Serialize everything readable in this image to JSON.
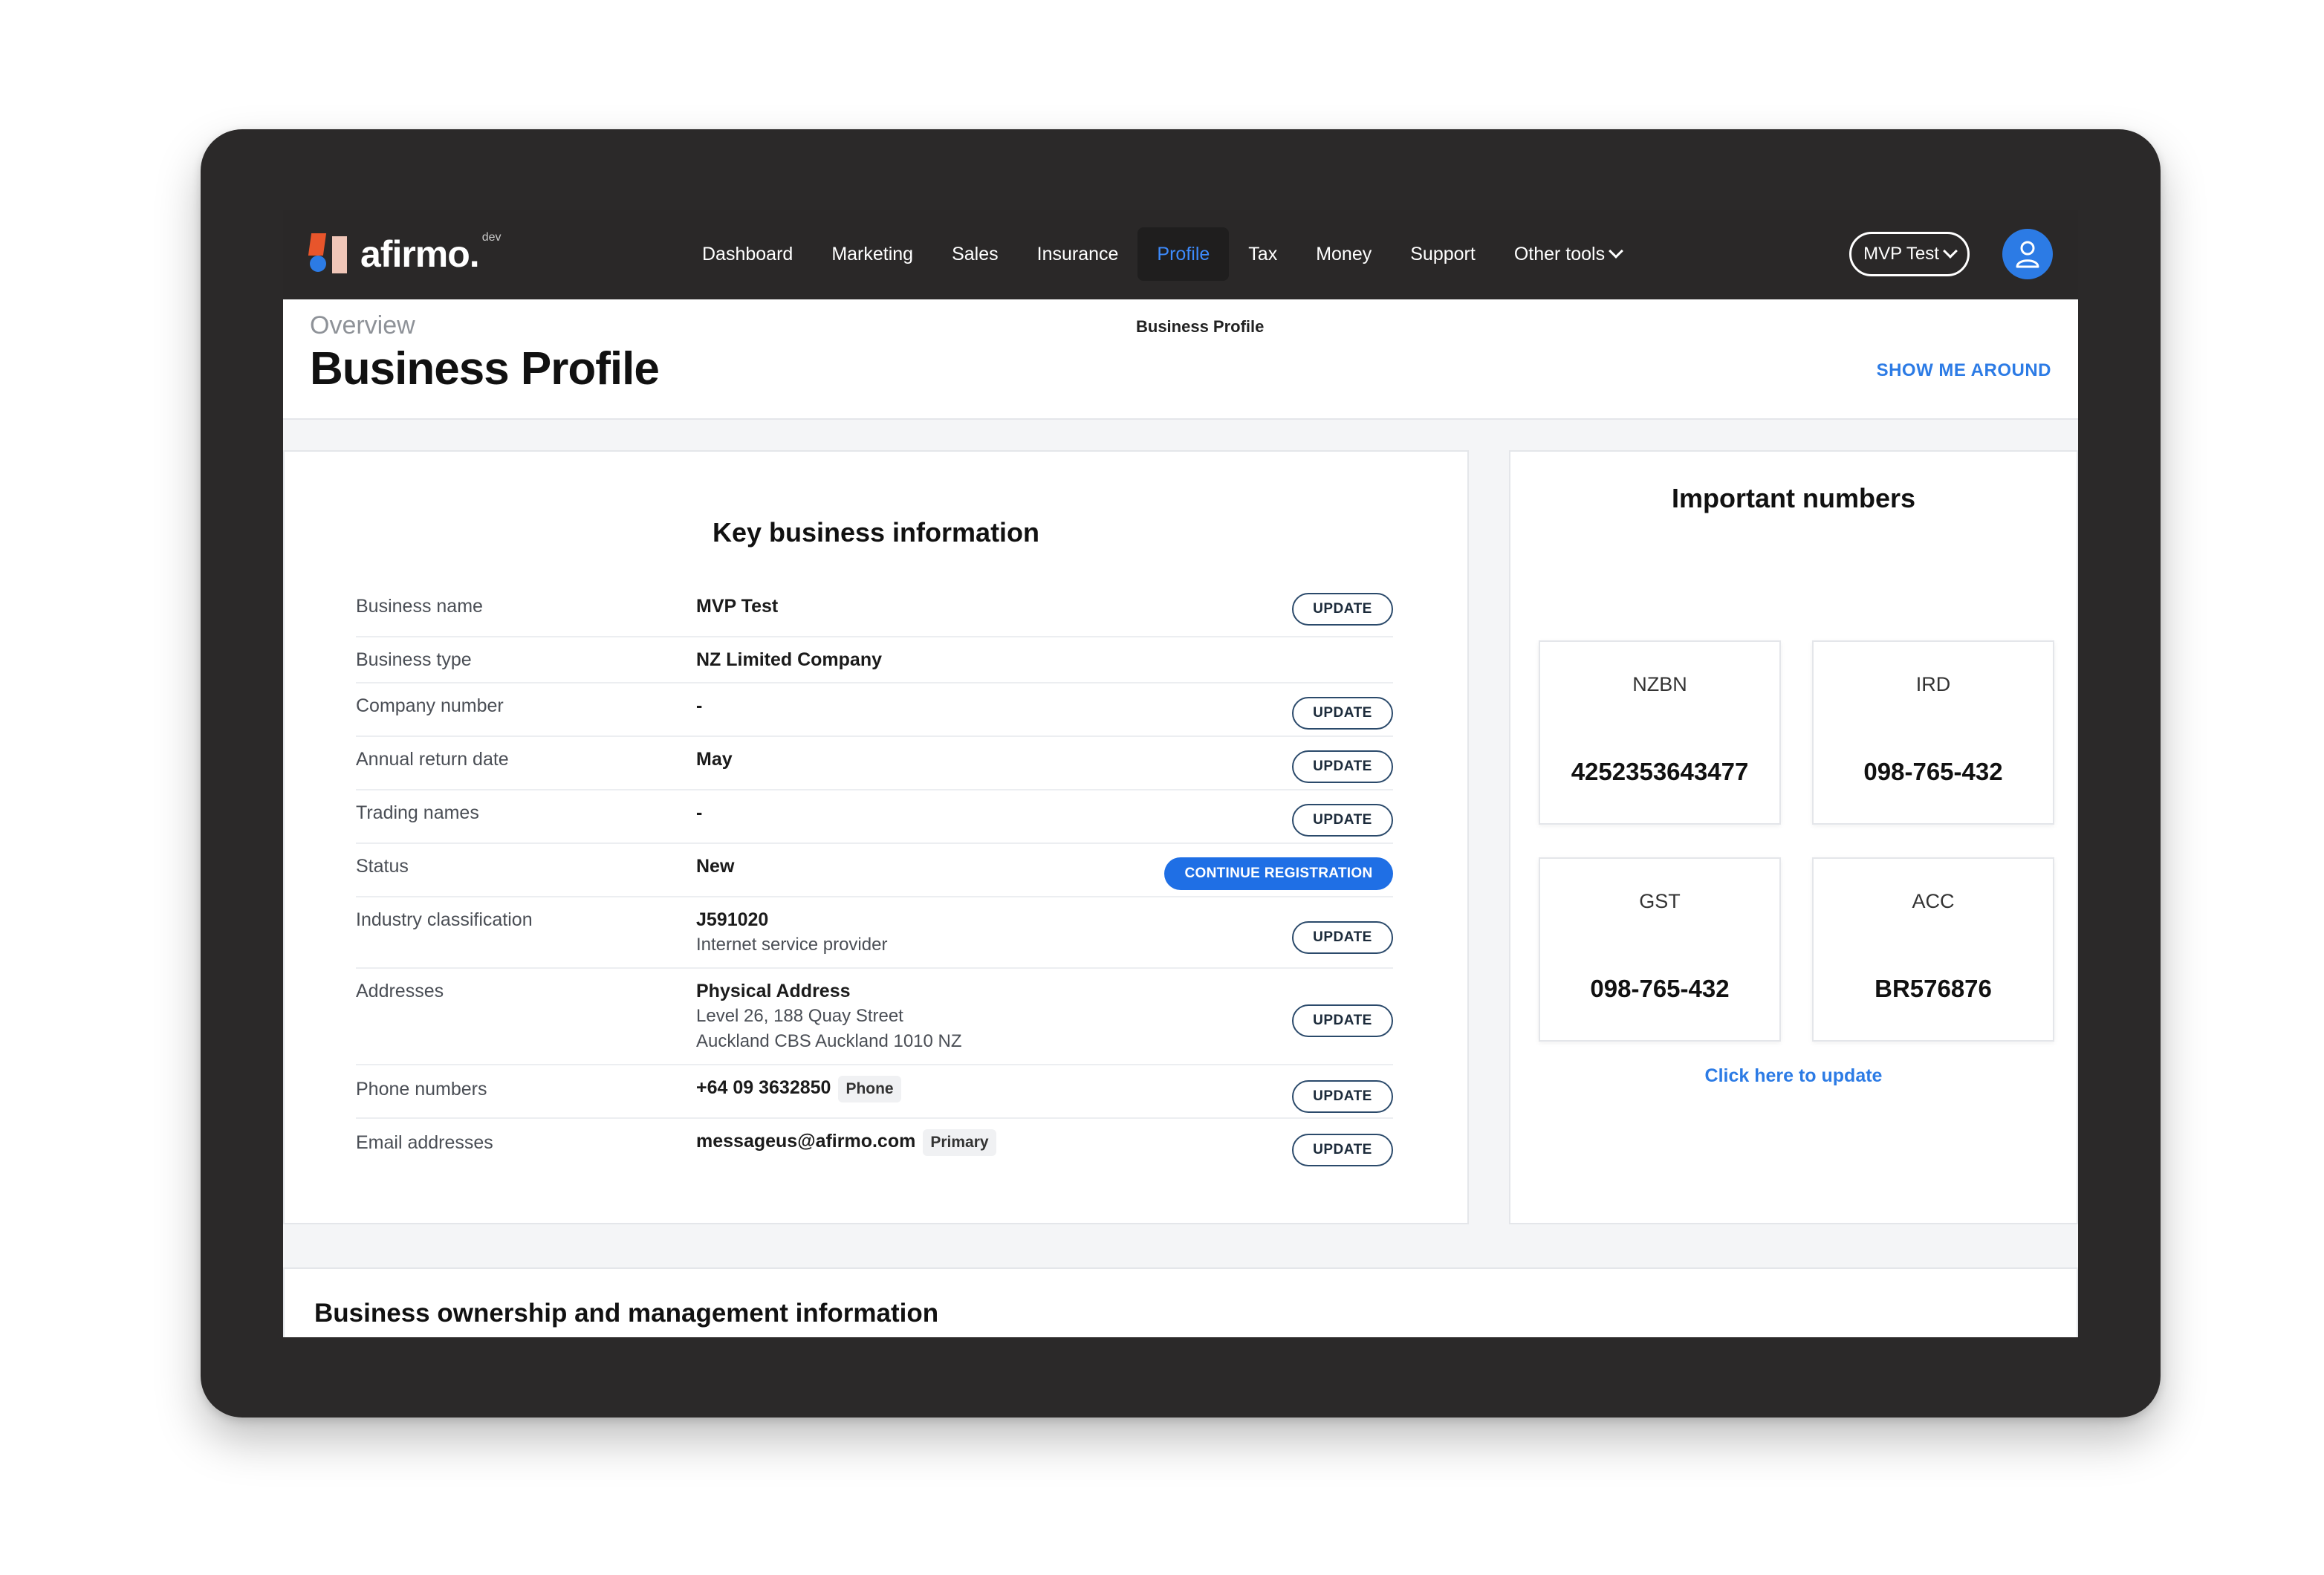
{
  "brand": {
    "name": "afirmo.",
    "env": "dev"
  },
  "nav": {
    "items": [
      "Dashboard",
      "Marketing",
      "Sales",
      "Insurance",
      "Profile",
      "Tax",
      "Money",
      "Support",
      "Other tools"
    ],
    "active": "Profile"
  },
  "account": {
    "label": "MVP Test"
  },
  "header": {
    "overview": "Overview",
    "title": "Business Profile",
    "breadcrumb": "Business Profile",
    "show_me_around": "SHOW ME AROUND"
  },
  "key_info": {
    "title": "Key business information",
    "update_label": "UPDATE",
    "continue_label": "CONTINUE REGISTRATION",
    "rows": {
      "business_name": {
        "label": "Business name",
        "value": "MVP Test"
      },
      "business_type": {
        "label": "Business type",
        "value": "NZ Limited Company"
      },
      "company_number": {
        "label": "Company number",
        "value": "-"
      },
      "annual_return": {
        "label": "Annual return date",
        "value": "May"
      },
      "trading_names": {
        "label": "Trading names",
        "value": "-"
      },
      "status": {
        "label": "Status",
        "value": "New"
      },
      "industry": {
        "label": "Industry classification",
        "value": "J591020",
        "sub": "Internet service provider"
      },
      "addresses": {
        "label": "Addresses",
        "value": "Physical Address",
        "line1": "Level 26, 188 Quay Street",
        "line2": "Auckland CBS Auckland 1010 NZ"
      },
      "phone": {
        "label": "Phone numbers",
        "value": "+64 09 3632850",
        "tag": "Phone"
      },
      "email": {
        "label": "Email addresses",
        "value": "messageus@afirmo.com",
        "tag": "Primary"
      }
    }
  },
  "important_numbers": {
    "title": "Important numbers",
    "tiles": [
      {
        "label": "NZBN",
        "value": "4252353643477"
      },
      {
        "label": "IRD",
        "value": "098-765-432"
      },
      {
        "label": "GST",
        "value": "098-765-432"
      },
      {
        "label": "ACC",
        "value": "BR576876"
      }
    ],
    "click_update": "Click here to update"
  },
  "ownership": {
    "title": "Business ownership and management information"
  },
  "colors": {
    "nav_bg": "#2a2828",
    "accent": "#2c7be5",
    "frame": "#2b2929",
    "logo_orange": "#e8552b"
  }
}
